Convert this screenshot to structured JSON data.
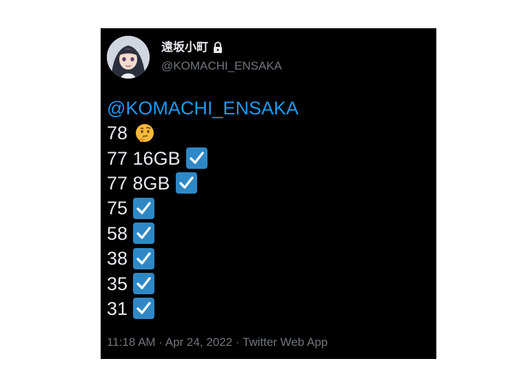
{
  "tweet": {
    "author": {
      "display_name": "遠坂小町",
      "handle": "@KOMACHI_ENSAKA",
      "protected_icon": "lock-icon"
    },
    "mention": "@KOMACHI_ENSAKA",
    "lines": [
      {
        "text": "78",
        "icon": "thinking-face-icon"
      },
      {
        "text": "77 16GB",
        "icon": "check-mark-icon"
      },
      {
        "text": "77 8GB",
        "icon": "check-mark-icon"
      },
      {
        "text": "75",
        "icon": "check-mark-icon"
      },
      {
        "text": "58",
        "icon": "check-mark-icon"
      },
      {
        "text": "38",
        "icon": "check-mark-icon"
      },
      {
        "text": "35",
        "icon": "check-mark-icon"
      },
      {
        "text": "31",
        "icon": "check-mark-icon"
      }
    ],
    "timestamp": "11:18 AM · Apr 24, 2022 · Twitter Web App"
  },
  "colors": {
    "card_background": "#000000",
    "text": "#e7e9ea",
    "mention": "#1d9bf0",
    "secondary_text": "#71767b",
    "check_box": "#2f88c6",
    "thinking_face": "#f6b93b"
  }
}
